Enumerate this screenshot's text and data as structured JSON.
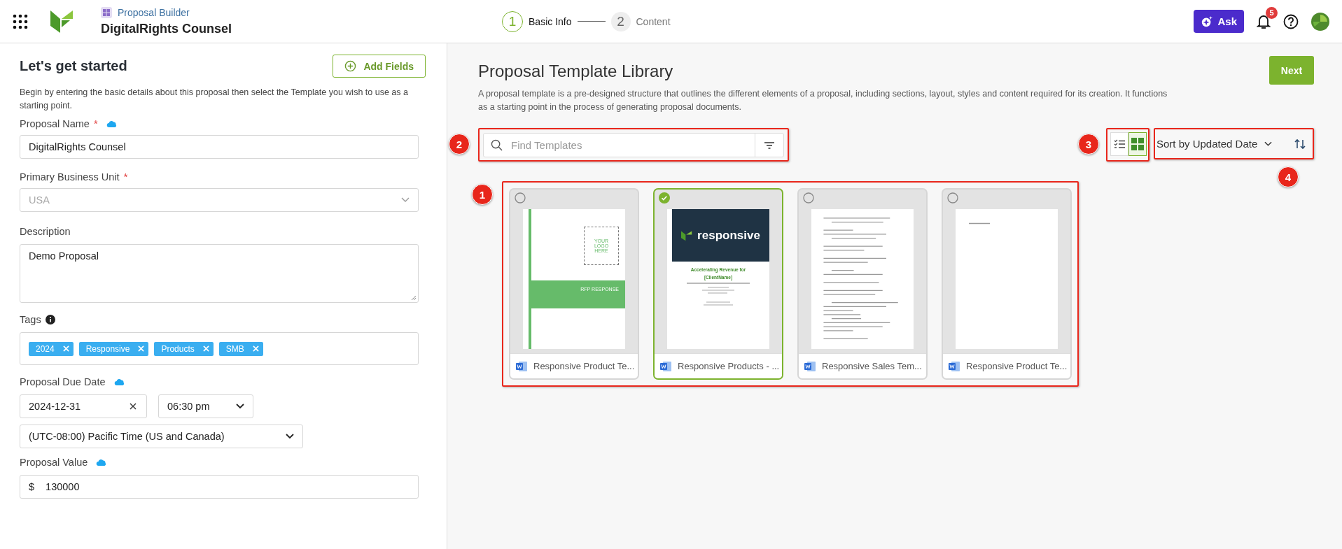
{
  "app_bar": {
    "module": "Proposal Builder",
    "title": "DigitalRights Counsel",
    "steps": [
      {
        "number": "1",
        "label": "Basic Info",
        "selected": true
      },
      {
        "number": "2",
        "label": "Content",
        "selected": false
      }
    ],
    "ask_label": "Ask",
    "notification_count": "5"
  },
  "form": {
    "title": "Let's get started",
    "add_fields_label": "Add Fields",
    "intro": "Begin by entering the basic details about this proposal then select the Template you wish to use as a starting point.",
    "fields": [
      {
        "kind": "text",
        "label": "Proposal Name",
        "required_mark": "*",
        "synced": true,
        "value": "DigitalRights Counsel"
      },
      {
        "kind": "select",
        "label": "Primary Business Unit",
        "required_mark": "*",
        "disabled": true,
        "value": "USA"
      },
      {
        "kind": "textarea",
        "label": "Description",
        "value": "Demo Proposal"
      },
      {
        "kind": "tags",
        "label": "Tags",
        "info": true,
        "tags": [
          "2024",
          "Responsive",
          "Products",
          "SMB"
        ]
      },
      {
        "kind": "datetime",
        "label": "Proposal Due Date",
        "synced": true,
        "date": "2024-12-31",
        "time": "06:30 pm",
        "timezone": "(UTC-08:00) Pacific Time (US and Canada)"
      },
      {
        "kind": "currency",
        "label": "Proposal Value",
        "synced": true,
        "currency": "$",
        "value": "130000"
      }
    ]
  },
  "library": {
    "title": "Proposal Template Library",
    "description": "A proposal template is a pre-designed structure that outlines the different elements of a proposal, including sections, layout, styles and content required for its creation. It functions as a starting point in the process of generating proposal documents.",
    "next_label": "Next",
    "search": {
      "placeholder": "Find Templates"
    },
    "views": [
      {
        "kind": "list",
        "selected": false
      },
      {
        "kind": "grid",
        "selected": true
      }
    ],
    "sort": {
      "label": "Sort by Updated Date"
    },
    "templates": [
      {
        "name": "Responsive Product Te...",
        "selected": false,
        "preview": {
          "kind": "logo-cover",
          "logo_text": "YOUR LOGO HERE",
          "band_text": "RFP RESPONSE"
        }
      },
      {
        "name": "Responsive Products - ...",
        "selected": true,
        "preview": {
          "kind": "brand-cover",
          "brand": "responsive",
          "heading": "Accelerating Revenue for",
          "client": "[ClientName]"
        }
      },
      {
        "name": "Responsive Sales Tem...",
        "selected": false,
        "preview": {
          "kind": "text-doc"
        }
      },
      {
        "name": "Responsive Product Te...",
        "selected": false,
        "preview": {
          "kind": "blank-doc"
        }
      }
    ]
  },
  "annotations": [
    {
      "number": "1"
    },
    {
      "number": "2"
    },
    {
      "number": "3"
    },
    {
      "number": "4"
    }
  ]
}
